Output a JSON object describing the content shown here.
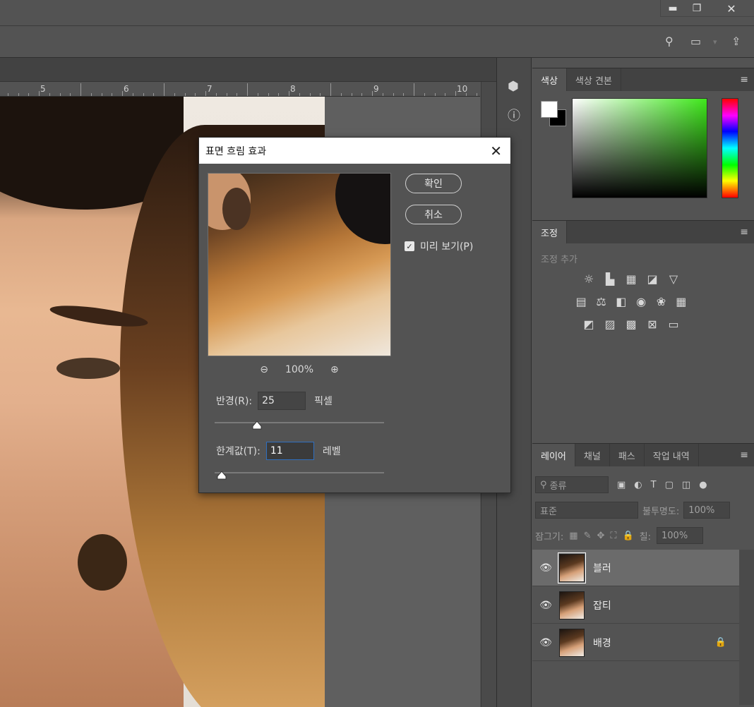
{
  "window": {
    "minimize_icon": "minimize-icon",
    "restore_icon": "restore-icon",
    "close_icon": "close-icon"
  },
  "toolbar": {
    "search_icon": "search-icon",
    "workspace_icon": "workspace-icon",
    "share_icon": "share-icon"
  },
  "ruler": {
    "labels": [
      "5",
      "6",
      "7",
      "8",
      "9",
      "10"
    ]
  },
  "dialog": {
    "title": "표면 흐림 효과",
    "ok_label": "확인",
    "cancel_label": "취소",
    "preview_label": "미리 보기(P)",
    "preview_checked": true,
    "zoom": "100%",
    "radius_label": "반경(R):",
    "radius_value": "25",
    "radius_unit": "픽셀",
    "radius_slider": 0.25,
    "threshold_label": "한계값(T):",
    "threshold_value": "11",
    "threshold_unit": "레벨",
    "threshold_slider": 0.04
  },
  "color_panel": {
    "tabs": [
      "색상",
      "색상 견본"
    ],
    "foreground": "#ffffff",
    "background": "#000000"
  },
  "adjust_panel": {
    "tab": "조정",
    "add_label": "조정 추가"
  },
  "layers_panel": {
    "tabs": [
      "레이어",
      "채널",
      "패스",
      "작업 내역"
    ],
    "filter_placeholder": "종류",
    "blend_mode": "표준",
    "opacity_label": "불투명도:",
    "opacity_value": "100%",
    "lock_label": "잠그기:",
    "fill_label": "칠:",
    "fill_value": "100%",
    "layers": [
      {
        "name": "블러",
        "selected": true,
        "locked": false
      },
      {
        "name": "잡티",
        "selected": false,
        "locked": false
      },
      {
        "name": "배경",
        "selected": false,
        "locked": true
      }
    ]
  }
}
